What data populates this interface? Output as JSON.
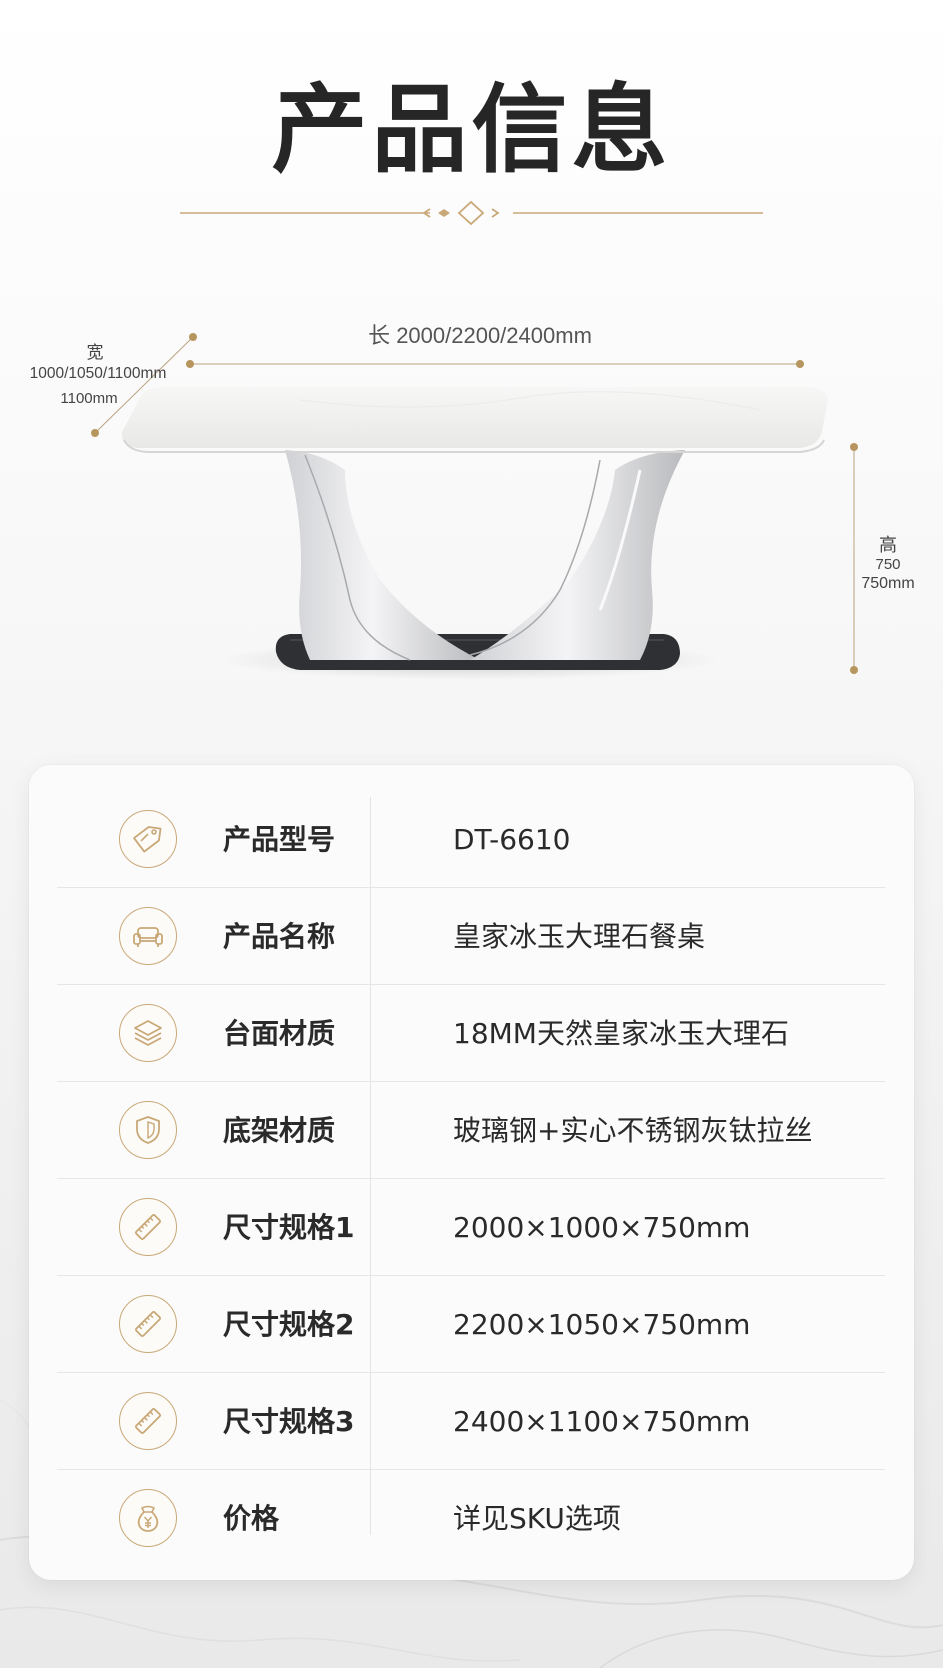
{
  "header": {
    "title": "产品信息"
  },
  "product_figure": {
    "length_label": "长 2000/2200/2400mm",
    "width_label_zh": "宽",
    "width_values": "1000/1050/1100mm",
    "width_values_2": "1100mm",
    "height_label_zh": "高",
    "height_value_1": "750",
    "height_value_2": "750mm"
  },
  "info_table": {
    "rows": [
      {
        "icon": "tag-icon",
        "label": "产品型号",
        "value": "DT-6610"
      },
      {
        "icon": "sofa-icon",
        "label": "产品名称",
        "value": "皇家冰玉大理石餐桌"
      },
      {
        "icon": "layers-icon",
        "label": "台面材质",
        "value": "18MM天然皇家冰玉大理石"
      },
      {
        "icon": "shield-icon",
        "label": "底架材质",
        "value": "玻璃钢+实心不锈钢灰钛拉丝"
      },
      {
        "icon": "ruler-icon",
        "label": "尺寸规格1",
        "value": "2000×1000×750mm"
      },
      {
        "icon": "ruler-icon",
        "label": "尺寸规格2",
        "value": "2200×1050×750mm"
      },
      {
        "icon": "ruler-icon",
        "label": "尺寸规格3",
        "value": "2400×1100×750mm"
      },
      {
        "icon": "yen-icon",
        "label": "价格",
        "value": "详见SKU选项"
      }
    ]
  },
  "colors": {
    "accent_gold": "#c9a878",
    "text_dark": "#2a2a2a",
    "card_bg": "#fbfbfb"
  }
}
